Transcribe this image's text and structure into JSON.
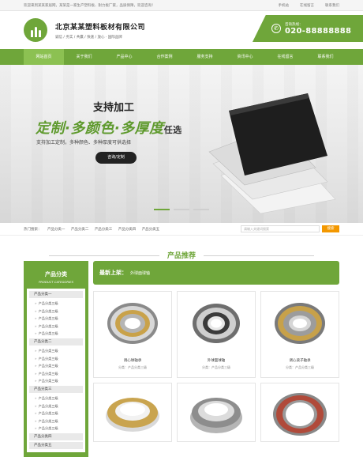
{
  "topbar": {
    "welcome": "欢迎来到某某家居网，某某是一家生产塑料板、耐力板厂家，品质保障，欢迎咨询！",
    "links": [
      "手机站",
      "在线留言",
      "联系我们"
    ]
  },
  "header": {
    "company": "北京某某塑料板材有限公司",
    "slogan": "诚信 / 务实 / 共赢 / 快速 / 放心 · 国际品牌",
    "hotline_label": "咨询热线：",
    "hotline": "020-88888888"
  },
  "nav": [
    "网站首页",
    "关于我们",
    "产品中心",
    "合作案例",
    "服务支持",
    "资讯中心",
    "在线留言",
    "联系我们"
  ],
  "banner": {
    "support": "支持加工",
    "headline": "定制·多颜色·多厚度",
    "headline_tail": "任选",
    "sub": "支持加工定制，多种颜色、多种厚度可供选择",
    "button": "咨询/定制"
  },
  "searchbar": {
    "hot_label": "热门搜索：",
    "hot": [
      "产品分类一",
      "产品分类二",
      "产品分类三",
      "产品分类四",
      "产品分类五"
    ],
    "placeholder": "请输入关键词搜索",
    "button": "搜索"
  },
  "products_section": {
    "title": "产品推荐",
    "subtitle": "PRODUCT CATEGORIES"
  },
  "sidebar": {
    "title": "产品分类",
    "subtitle": "PRODUCT CATEGORIES",
    "groups": [
      {
        "name": "产品分类一",
        "subs": [
          "产品分类三级",
          "产品分类三级",
          "产品分类三级",
          "产品分类三级",
          "产品分类三级"
        ]
      },
      {
        "name": "产品分类二",
        "subs": [
          "产品分类三级",
          "产品分类三级",
          "产品分类三级",
          "产品分类三级",
          "产品分类三级"
        ]
      },
      {
        "name": "产品分类三",
        "subs": [
          "产品分类三级",
          "产品分类三级",
          "产品分类三级",
          "产品分类三级",
          "产品分类三级"
        ]
      },
      {
        "name": "产品分类四",
        "subs": []
      },
      {
        "name": "产品分类五",
        "subs": []
      }
    ]
  },
  "products": {
    "new_label": "最新上架：",
    "new_item": "外球面球轴",
    "items": [
      {
        "name": "调心球轴承",
        "cat": "分类：产品分类三级"
      },
      {
        "name": "外球面球轴",
        "cat": "分类：产品分类三级"
      },
      {
        "name": "调心滚子轴承",
        "cat": "分类：产品分类三级"
      },
      {
        "name": "",
        "cat": ""
      },
      {
        "name": "",
        "cat": ""
      },
      {
        "name": "",
        "cat": ""
      }
    ]
  },
  "colors": {
    "brand_green": "#6fa63a",
    "accent_orange": "#f39800"
  }
}
